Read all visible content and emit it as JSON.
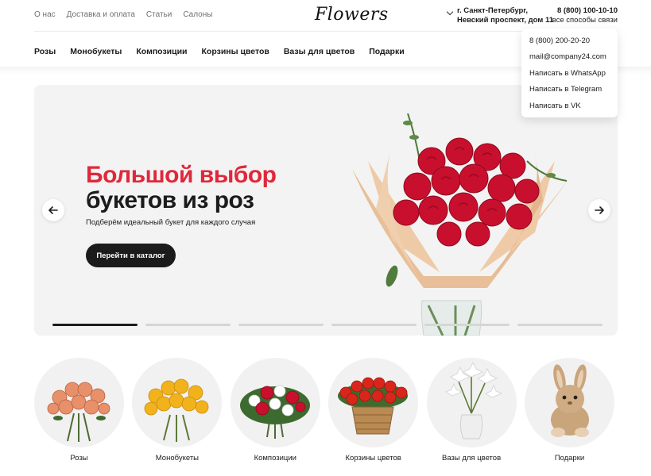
{
  "header": {
    "top_links": [
      "О нас",
      "Доставка и оплата",
      "Статьи",
      "Салоны"
    ],
    "logo": "Flowers",
    "address_line1": "г. Санкт-Петербург,",
    "address_line2": "Невский проспект, дом 11",
    "phone": "8 (800) 100-10-10",
    "contact_ways": "все способы связи"
  },
  "nav": {
    "items": [
      "Розы",
      "Монобукеты",
      "Композиции",
      "Корзины цветов",
      "Вазы для цветов",
      "Подарки"
    ]
  },
  "contact_dropdown": {
    "items": [
      "8 (800) 200-20-20",
      "mail@company24.com",
      "Написать в WhatsApp",
      "Написать в Telegram",
      "Написать в VK"
    ]
  },
  "hero": {
    "title_line1": "Большой выбор",
    "title_line2": "букетов из роз",
    "subtitle": "Подберём идеальный букет для каждого случая",
    "cta": "Перейти в каталог",
    "slides_total": 6,
    "active_slide": 1,
    "accent_color": "#e0283b"
  },
  "categories": [
    {
      "label": "Розы",
      "icon": "peach-roses-bouquet"
    },
    {
      "label": "Монобукеты",
      "icon": "yellow-chrysanthemum-bouquet"
    },
    {
      "label": "Композиции",
      "icon": "mixed-flowers-composition"
    },
    {
      "label": "Корзины цветов",
      "icon": "flower-basket"
    },
    {
      "label": "Вазы для цветов",
      "icon": "lilies-in-vase"
    },
    {
      "label": "Подарки",
      "icon": "plush-bunny"
    }
  ]
}
